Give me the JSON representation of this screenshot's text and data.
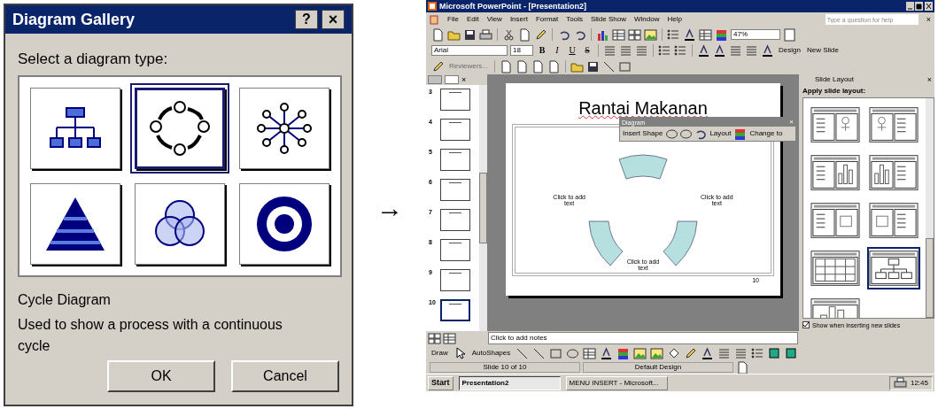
{
  "dialog": {
    "title": "Diagram Gallery",
    "help_glyph": "?",
    "close_glyph": "×",
    "prompt": "Select a diagram type:",
    "types": [
      {
        "kind": "org",
        "selected": false
      },
      {
        "kind": "cycle",
        "selected": true
      },
      {
        "kind": "radial",
        "selected": false
      },
      {
        "kind": "pyramid",
        "selected": false
      },
      {
        "kind": "venn",
        "selected": false
      },
      {
        "kind": "target",
        "selected": false
      }
    ],
    "type_name": "Cycle Diagram",
    "description": "Used to show a process with a continuous cycle",
    "buttons": [
      "OK",
      "Cancel"
    ]
  },
  "arrow": "→",
  "app": {
    "title": "Microsoft PowerPoint - [Presentation2]",
    "menu": [
      "File",
      "Edit",
      "View",
      "Insert",
      "Format",
      "Tools",
      "Slide Show",
      "Window",
      "Help"
    ],
    "help_placeholder": "Type a question for help",
    "zoom": "47%",
    "font": "Arial",
    "font_size": "18",
    "format_buttons": [
      "B",
      "I",
      "U",
      "S"
    ],
    "design": "Design",
    "new_slide": "New Slide",
    "reviewers": {
      "label": "Reviewers...",
      "disabled": true
    },
    "slides": [
      {
        "number": "3",
        "selected": false
      },
      {
        "number": "4",
        "selected": false
      },
      {
        "number": "5",
        "selected": false
      },
      {
        "number": "6",
        "selected": false
      },
      {
        "number": "7",
        "selected": false
      },
      {
        "number": "8",
        "selected": false
      },
      {
        "number": "9",
        "selected": false
      },
      {
        "number": "10",
        "selected": true
      }
    ],
    "slide": {
      "title": "Rantai Makanan",
      "placeholders": [
        "Click to add text",
        "Click to add text",
        "Click to add text"
      ],
      "number": "10"
    },
    "diagram_toolbar": {
      "title": "Diagram",
      "insert_shape": "Insert Shape",
      "layout": "Layout",
      "change_to": "Change to"
    },
    "task_pane": {
      "title": "Slide Layout",
      "heading": "Apply slide layout:",
      "layouts": [
        {
          "kind": "text-clipart",
          "selected": false
        },
        {
          "kind": "clipart-text",
          "selected": false
        },
        {
          "kind": "text-chart",
          "selected": false
        },
        {
          "kind": "chart-text",
          "selected": false
        },
        {
          "kind": "text-media",
          "selected": false
        },
        {
          "kind": "media-text",
          "selected": false
        },
        {
          "kind": "table",
          "selected": false
        },
        {
          "kind": "diagram",
          "selected": true
        },
        {
          "kind": "chart",
          "selected": false
        }
      ],
      "show_option": {
        "label": "Show when inserting new slides",
        "checked": true
      }
    },
    "notes_placeholder": "Click to add notes",
    "draw": "Draw",
    "autoshapes": "AutoShapes",
    "status": [
      "Slide 10 of 10",
      "Default Design"
    ],
    "taskbar": {
      "start": "Start",
      "tasks": [
        {
          "label": "Presentation2",
          "selected": true
        },
        {
          "label": "MENU INSERT - Microsoft...",
          "selected": false
        }
      ],
      "clock": "12:45"
    }
  }
}
